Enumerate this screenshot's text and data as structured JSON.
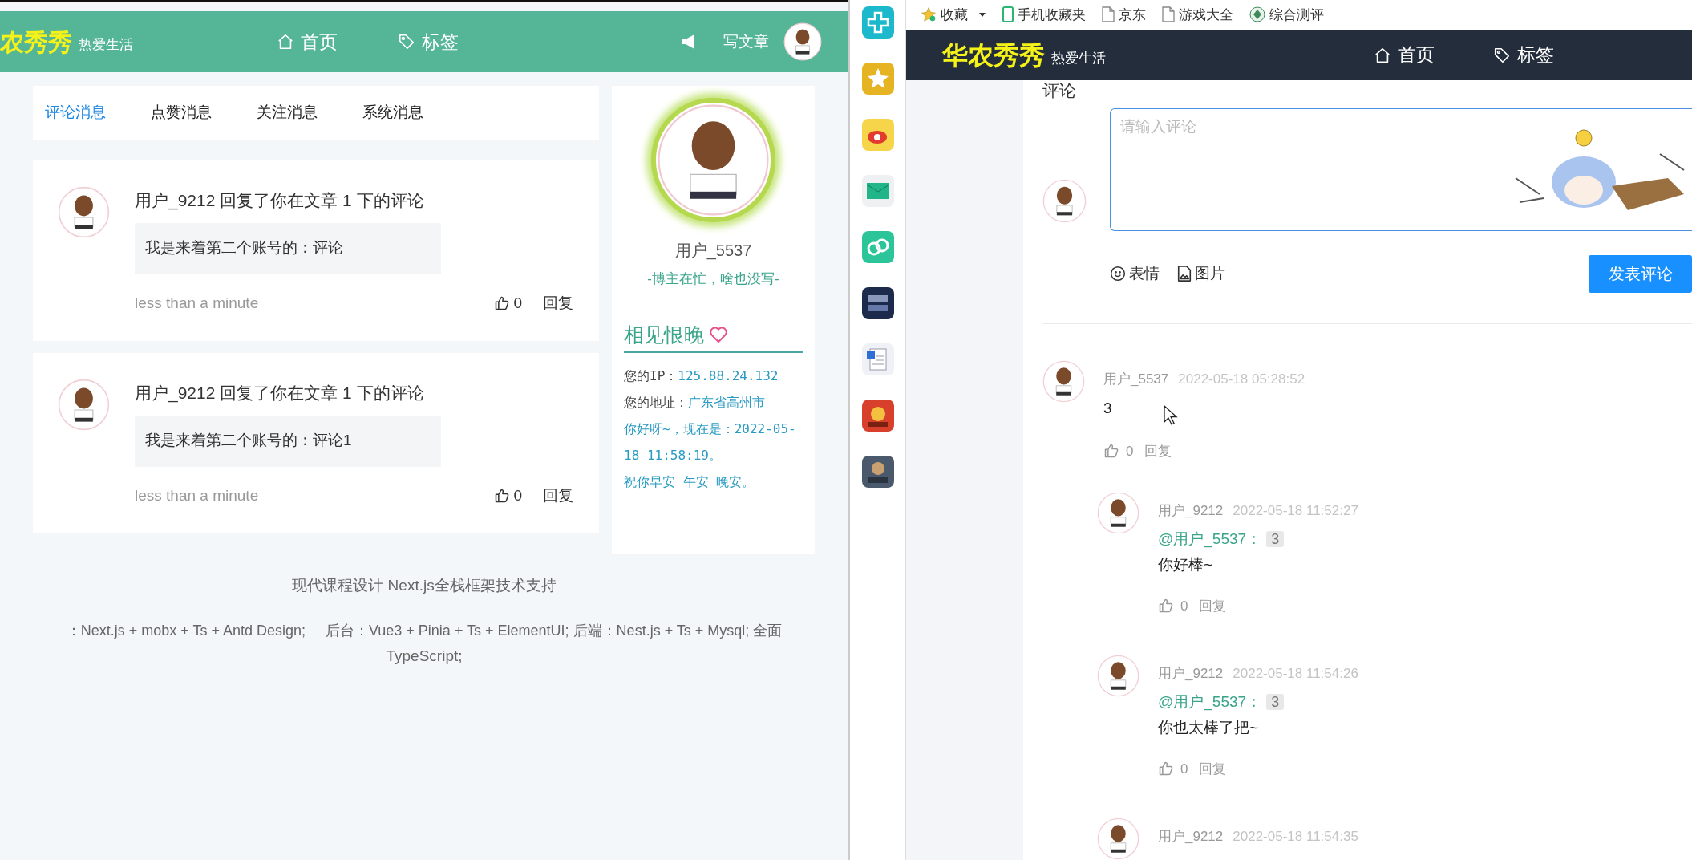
{
  "left_window": {
    "header": {
      "logo": "农秀秀",
      "slogan": "热爱生活",
      "nav": [
        {
          "label": "首页",
          "kind": "home"
        },
        {
          "label": "标签",
          "kind": "tag"
        }
      ],
      "write_button": "写文章"
    },
    "tabs": [
      {
        "label": "评论消息",
        "selected": true
      },
      {
        "label": "点赞消息",
        "selected": false
      },
      {
        "label": "关注消息",
        "selected": false
      },
      {
        "label": "系统消息",
        "selected": false
      }
    ],
    "messages": [
      {
        "title_before": "用户_9212 回复了你在文章",
        "article": "1",
        "title_after": "下的评论",
        "quote": "我是来着第二个账号的：评论",
        "time": "less than a minute",
        "likes": "0",
        "reply": "回复"
      },
      {
        "title_before": "用户_9212 回复了你在文章",
        "article": "1",
        "title_after": "下的评论",
        "quote": "我是来着第二个账号的：评论1",
        "time": "less than a minute",
        "likes": "0",
        "reply": "回复"
      }
    ],
    "profile": {
      "name": "用户_5537",
      "motto": "-博主在忙，啥也没写-",
      "section_title": "相见恨晚",
      "info": [
        {
          "label": "您的IP：",
          "value": "125.88.24.132"
        },
        {
          "label": "您的地址：",
          "value": "广东省高州市"
        }
      ],
      "greeting": "你好呀~，现在是：2022-05-18 11:58:19。",
      "wish": "祝你早安 午安 晚安。"
    },
    "footer": [
      "现代课程设计 Next.js全栈框架技术支持",
      "：Next.js + mobx + Ts + Antd Design;     后台：Vue3 + Pinia + Ts + ElementUI; 后端：Nest.js + Ts + Mysql; 全面",
      "TypeScript;"
    ]
  },
  "bookmarks": [
    {
      "label": "收藏",
      "kind": "star",
      "dropdown": true
    },
    {
      "label": "手机收藏夹",
      "kind": "phone",
      "dropdown": false
    },
    {
      "label": "京东",
      "kind": "page",
      "dropdown": false
    },
    {
      "label": "游戏大全",
      "kind": "page",
      "dropdown": false
    },
    {
      "label": "综合测评",
      "kind": "badge",
      "dropdown": false
    }
  ],
  "right_window": {
    "header": {
      "logo": "华农秀秀",
      "slogan": "热爱生活",
      "nav": [
        {
          "label": "首页",
          "kind": "home"
        },
        {
          "label": "标签",
          "kind": "tag"
        }
      ]
    },
    "comment_form": {
      "heading": "评论",
      "placeholder": "请输入评论",
      "tools": [
        {
          "label": "表情",
          "kind": "emoji"
        },
        {
          "label": "图片",
          "kind": "image"
        }
      ],
      "submit": "发表评论"
    },
    "comments": [
      {
        "user": "用户_5537",
        "time": "2022-05-18 05:28:52",
        "text": "3",
        "likes": "0",
        "reply": "回复",
        "children": [
          {
            "user": "用户_9212",
            "time": "2022-05-18 11:52:27",
            "mention": "@用户_5537：",
            "quoted": "3",
            "text": "你好棒~",
            "likes": "0",
            "reply": "回复"
          },
          {
            "user": "用户_9212",
            "time": "2022-05-18 11:54:26",
            "mention": "@用户_5537：",
            "quoted": "3",
            "text": "你也太棒了把~",
            "likes": "0",
            "reply": "回复"
          },
          {
            "user": "用户_9212",
            "time": "2022-05-18 11:54:35"
          }
        ]
      }
    ]
  }
}
